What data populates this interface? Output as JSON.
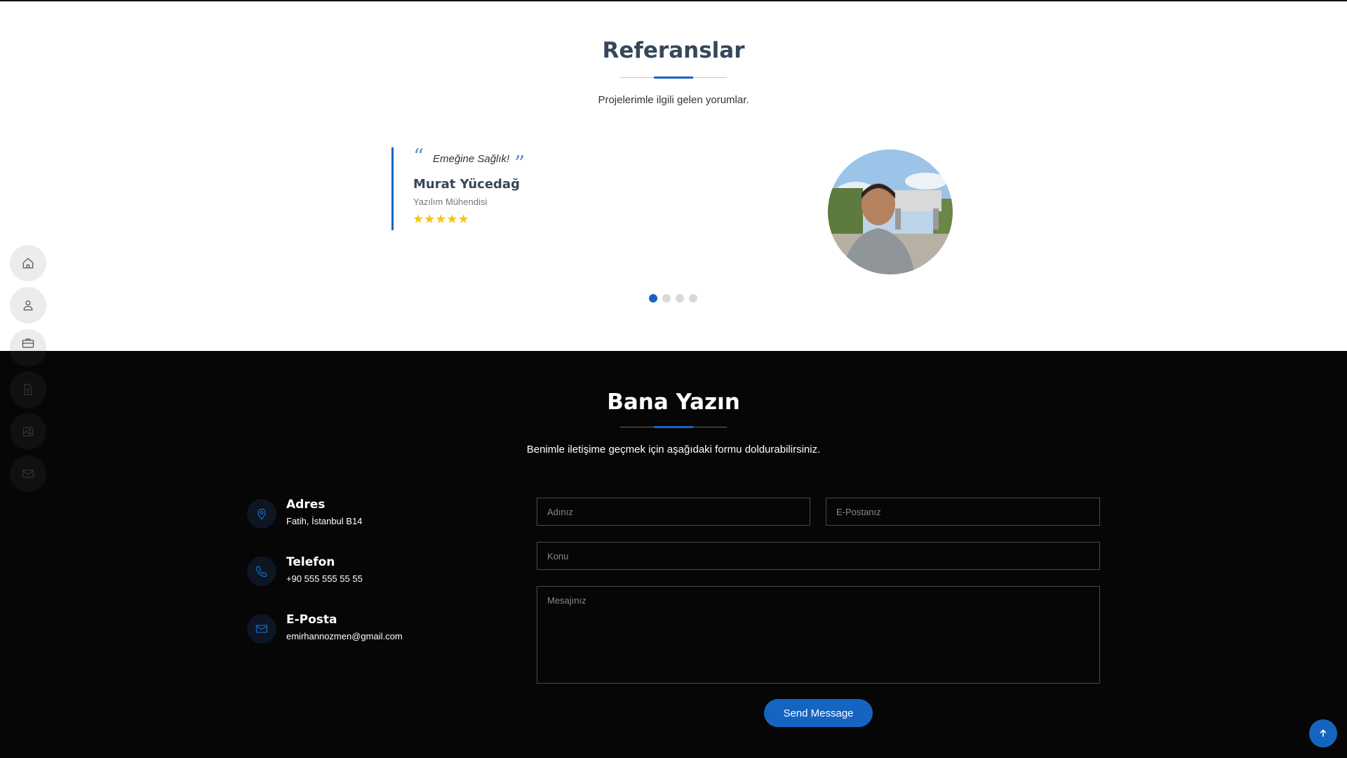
{
  "references": {
    "title": "Referanslar",
    "subtitle": "Projelerimle ilgili gelen yorumlar.",
    "testimonial": {
      "quote": "Emeğine Sağlık!",
      "author": "Murat Yücedağ",
      "role": "Yazılım Mühendisi",
      "rating": 5,
      "stars": "★★★★★"
    },
    "carousel": {
      "slides": 4,
      "active": 1
    }
  },
  "side_nav": {
    "items": [
      "home-icon",
      "user-icon",
      "briefcase-icon",
      "document-icon",
      "image-icon",
      "envelope-icon"
    ]
  },
  "contact": {
    "title": "Bana Yazın",
    "subtitle": "Benimle iletişime geçmek için aşağıdaki formu doldurabilirsiniz.",
    "info": {
      "address": {
        "title": "Adres",
        "text": "Fatih, İstanbul B14",
        "icon": "map-pin-icon"
      },
      "phone": {
        "title": "Telefon",
        "text": "+90 555 555 55 55",
        "icon": "phone-icon"
      },
      "email": {
        "title": "E-Posta",
        "text": "emirhannozmen@gmail.com",
        "icon": "envelope-icon"
      }
    },
    "form": {
      "name_placeholder": "Adınız",
      "email_placeholder": "E-Postanız",
      "subject_placeholder": "Konu",
      "message_placeholder": "Mesajınız",
      "submit_label": "Send Message"
    }
  },
  "colors": {
    "accent": "#1565c0",
    "heading_dark": "#37475a",
    "star": "#f5c518",
    "contact_bg": "#060606"
  }
}
